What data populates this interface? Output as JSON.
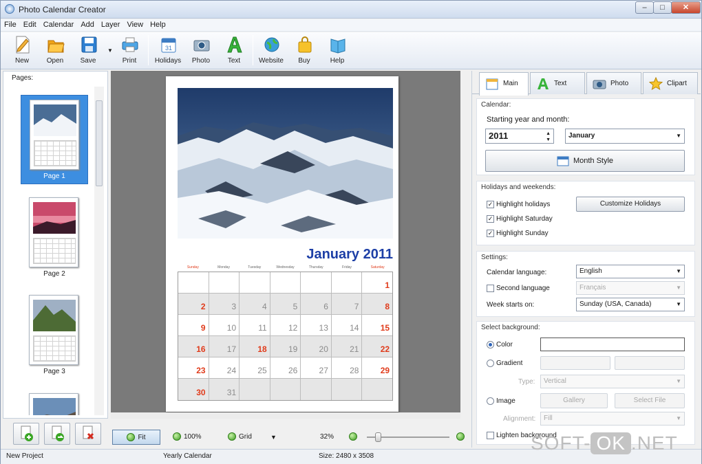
{
  "window": {
    "title": "Photo Calendar Creator",
    "min": "–",
    "max": "□",
    "close": "✕"
  },
  "menu": [
    "File",
    "Edit",
    "Calendar",
    "Add",
    "Layer",
    "View",
    "Help"
  ],
  "toolbar": [
    {
      "label": "New",
      "icon": "new-document-icon"
    },
    {
      "label": "Open",
      "icon": "open-folder-icon"
    },
    {
      "label": "Save",
      "icon": "save-disk-icon"
    },
    {
      "label": "Print",
      "icon": "printer-icon"
    },
    {
      "label": "Holidays",
      "icon": "holidays-calendar-icon"
    },
    {
      "label": "Photo",
      "icon": "photo-camera-icon"
    },
    {
      "label": "Text",
      "icon": "text-a-icon"
    },
    {
      "label": "Website",
      "icon": "website-globe-icon"
    },
    {
      "label": "Buy",
      "icon": "shopping-bag-icon"
    },
    {
      "label": "Help",
      "icon": "help-book-icon"
    }
  ],
  "pages_panel": {
    "title": "Pages:",
    "pages": [
      {
        "label": "Page 1",
        "selected": true
      },
      {
        "label": "Page 2",
        "selected": false
      },
      {
        "label": "Page 3",
        "selected": false
      },
      {
        "label": "",
        "selected": false
      }
    ]
  },
  "preview": {
    "month_title": "January 2011",
    "weekdays": [
      "Sunday",
      "Monday",
      "Tuesday",
      "Wednesday",
      "Thursday",
      "Friday",
      "Saturday"
    ],
    "weeks": [
      [
        "",
        "",
        "",
        "",
        "",
        "",
        "1"
      ],
      [
        "2",
        "3",
        "4",
        "5",
        "6",
        "7",
        "8"
      ],
      [
        "9",
        "10",
        "11",
        "12",
        "13",
        "14",
        "15"
      ],
      [
        "16",
        "17",
        "18",
        "19",
        "20",
        "21",
        "22"
      ],
      [
        "23",
        "24",
        "25",
        "26",
        "27",
        "28",
        "29"
      ],
      [
        "30",
        "31",
        "",
        "",
        "",
        "",
        ""
      ]
    ],
    "holiday_day": "18"
  },
  "zoombar": {
    "fit": "Fit",
    "hundred": "100%",
    "grid": "Grid",
    "zoom": "32%"
  },
  "tabs": [
    "Main",
    "Text",
    "Photo",
    "Clipart"
  ],
  "calendar_section": {
    "title": "Calendar:",
    "start_label": "Starting year and month:",
    "year": "2011",
    "month": "January",
    "month_style_btn": "Month Style"
  },
  "holidays_section": {
    "title": "Holidays and weekends:",
    "items": [
      "Highlight holidays",
      "Highlight Saturday",
      "Highlight Sunday"
    ],
    "customize_btn": "Customize Holidays"
  },
  "settings_section": {
    "title": "Settings:",
    "lang_label": "Calendar language:",
    "lang_value": "English",
    "second_label": "Second language",
    "second_value": "Français",
    "week_label": "Week starts on:",
    "week_value": "Sunday (USA, Canada)"
  },
  "background_section": {
    "title": "Select background:",
    "color": "Color",
    "gradient": "Gradient",
    "type_label": "Type:",
    "type_value": "Vertical",
    "image": "Image",
    "gallery_btn": "Gallery",
    "select_file_btn": "Select File",
    "alignment_label": "Alignment:",
    "alignment_value": "Fill",
    "lighten": "Lighten background"
  },
  "status": {
    "project": "New Project",
    "type": "Yearly Calendar",
    "size": "Size: 2480 x 3508"
  },
  "watermark": {
    "a": "SOFT-",
    "b": "OK",
    "c": ".NET"
  },
  "colors": {
    "accent": "#3d8ee0",
    "month_title": "#1d3fa6",
    "weekend_red": "#e03b1b"
  }
}
